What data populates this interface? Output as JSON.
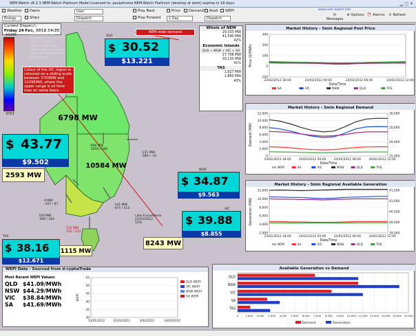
{
  "window": {
    "title": "NEM-Watch v6.2.3 NEM-Watch Platinum Model    Licensed to: paulathome    NEM-Watch Platinum (desktop at work) expires in 18 days.",
    "url": "www.nem-watch.info"
  },
  "toolbar": {
    "checkboxes": [
      {
        "label": "Weather"
      },
      {
        "label": "Dams"
      },
      {
        "label": "Energy"
      },
      {
        "label": "Ships"
      },
      {
        "label": "Play Back"
      },
      {
        "label": "Play Forward"
      },
      {
        "label": "Price"
      },
      {
        "label": "Demand"
      },
      {
        "label": "Avail"
      },
      {
        "label": "WEPI"
      },
      {
        "label": "Dispatch"
      }
    ],
    "user_select": "User",
    "energy_select": "Energy",
    "dispatch_select": "Dispatch",
    "interval_select": "1 Day",
    "dispatch2_select": "Dispatch",
    "buttons": {
      "messages": "Messages",
      "options": "Options",
      "alarms": "Alarms",
      "refresh": "Refresh"
    }
  },
  "current_dispatch": {
    "label": "Current Dispatch:",
    "value": "Friday 24 Feb, 2012 14:25"
  },
  "scale": {
    "max": "10296",
    "min": "3703"
  },
  "info_note": "NEM-Watch only receives data sets when they are released for the first time - in other words, price (or other data) revisions are not received by NEM-Watch.",
  "annotations": {
    "vic_colour": "Colour of the VIC region is coloured on a sliding scale between 3703MW and 10296MW, where the upper range is all-time max on same basis.",
    "nem_demand": "NEM-wide demand"
  },
  "regions": {
    "qld": {
      "code": "QLD",
      "price": "30.52",
      "volume": "$13.221",
      "demand": "6798 MW"
    },
    "sa": {
      "price": "43.77",
      "volume": "$9.502",
      "demand": "2593 MW"
    },
    "nsw": {
      "code": "NSW",
      "price": "34.87",
      "volume": "$9.563",
      "demand": "10584 MW"
    },
    "vic": {
      "code": "VIC",
      "price": "39.88",
      "volume": "$8.855",
      "demand": "8243 MW"
    },
    "tas": {
      "code": "TAS",
      "price": "38.16",
      "volume": "$12.671",
      "demand": "1115 MW"
    }
  },
  "dollar": "$",
  "interconnectors": {
    "qni": "-946 MW",
    "qni_sub": "-1059 / 269",
    "dirlink": "-121 MW",
    "dirlink_sub": "-180 / -33",
    "vic_nsw": "-341 MW",
    "vic_nsw_sub": "-475 / 413",
    "murraylink": "9 MW",
    "murraylink_sub": "-107 / 87",
    "heywood": "330 MW",
    "heywood_sub": "-460 / 362",
    "basslink": "512 MW",
    "basslink_sub": "512 / 512"
  },
  "lake": {
    "label": "Lake Eucumbene",
    "date": "21/02/2012",
    "pct": "53%"
  },
  "whole_nem": {
    "title": "Whole of NEM",
    "rows": [
      {
        "value": "29,333 MW"
      },
      {
        "value": "41,590 MW"
      },
      {
        "value": "42%"
      }
    ],
    "islands_title": "Economic Islands",
    "islands_sub": "QLD + NSW + VIC + SA",
    "island_rows": [
      {
        "value": "27,706 MW"
      },
      {
        "value": "39,130 MW"
      },
      {
        "value": "41%"
      }
    ],
    "tas_title": "TAS",
    "tas_rows": [
      {
        "value": "1,627 MW"
      },
      {
        "value": "2,860 MW"
      },
      {
        "value": "43%"
      }
    ]
  },
  "chart_data": [
    {
      "type": "line",
      "title": "Market History - 5min Regional Pool Price",
      "ylabel": "Price ($/MWh)",
      "xlabel": "Date/Time",
      "x_ticks": [
        "23/02/2012 18:00",
        "24/02/2012 00:00",
        "24/02/2012 06:00",
        "24/02/2012 12:00"
      ],
      "y_ticks": [
        "300",
        "200",
        "100",
        "0",
        "-100"
      ],
      "ylim": [
        -100,
        300
      ],
      "legend": [
        "SA",
        "VIC",
        "NSW",
        "QLD",
        "TAS"
      ],
      "series": [
        {
          "name": "SA",
          "values": [
            45,
            42,
            40,
            38,
            35,
            30,
            28,
            30,
            34,
            38,
            40,
            42,
            44
          ]
        },
        {
          "name": "VIC",
          "values": [
            40,
            38,
            36,
            34,
            30,
            24,
            20,
            22,
            28,
            33,
            36,
            38,
            40
          ]
        },
        {
          "name": "NSW",
          "values": [
            36,
            34,
            33,
            32,
            30,
            26,
            22,
            24,
            28,
            31,
            33,
            34,
            35
          ]
        },
        {
          "name": "QLD",
          "values": [
            32,
            30,
            30,
            29,
            27,
            24,
            20,
            22,
            26,
            28,
            29,
            30,
            30
          ]
        },
        {
          "name": "TAS",
          "values": [
            40,
            39,
            38,
            38,
            36,
            34,
            32,
            33,
            35,
            37,
            38,
            38,
            38
          ]
        }
      ]
    },
    {
      "type": "line",
      "title": "Market History - 5min Regional Demand",
      "ylabel": "Demand (MW)",
      "xlabel": "Date/Time",
      "x_ticks": [
        "23/02/2012 18:00",
        "24/02/2012 00:00",
        "24/02/2012 06:00",
        "24/02/2012 12:00"
      ],
      "y_ticks": [
        "12,000",
        "10,000",
        "8,000",
        "6,000",
        "4,000",
        "2,000",
        "0"
      ],
      "y2_ticks": [
        "30,000",
        "25,000",
        "20,000",
        "15,000"
      ],
      "ylim": [
        0,
        12000
      ],
      "legend": [
        "NEM",
        "SA",
        "VIC",
        "NSW",
        "QLD",
        "TAS"
      ],
      "series": [
        {
          "name": "NSW",
          "values": [
            10200,
            9800,
            9000,
            8000,
            7200,
            6800,
            7000,
            8200,
            9600,
            10400,
            10600,
            10584
          ]
        },
        {
          "name": "VIC",
          "values": [
            8000,
            7600,
            7000,
            6200,
            5600,
            5200,
            5400,
            6400,
            7600,
            8200,
            8300,
            8243
          ]
        },
        {
          "name": "QLD",
          "values": [
            6900,
            6800,
            6600,
            6200,
            5800,
            5600,
            5700,
            6000,
            6500,
            6800,
            6800,
            6798
          ]
        },
        {
          "name": "SA",
          "values": [
            2600,
            2500,
            2300,
            2000,
            1800,
            1700,
            1800,
            2100,
            2400,
            2550,
            2600,
            2593
          ]
        },
        {
          "name": "TAS",
          "values": [
            1200,
            1150,
            1100,
            1000,
            950,
            900,
            950,
            1050,
            1100,
            1120,
            1115,
            1115
          ]
        }
      ]
    },
    {
      "type": "line",
      "title": "Market History - 5min Regional Available Generation",
      "ylabel": "Generation (MW)",
      "xlabel": "Date/Time",
      "x_ticks": [
        "23/02/2012 18:00",
        "24/02/2012 00:00",
        "24/02/2012 06:00",
        "24/02/2012 12:00"
      ],
      "y_ticks": [
        "12,000",
        "10,000",
        "8,000",
        "6,000",
        "4,000",
        "2,000"
      ],
      "y2_ticks": [
        "41,500",
        "41,000",
        "40,500",
        "40,000",
        "39,500"
      ],
      "ylim": [
        0,
        12000
      ],
      "legend": [
        "NEM",
        "SA",
        "VIC",
        "NSW",
        "QLD",
        "TAS"
      ],
      "series": [
        {
          "name": "NSW",
          "values": [
            12000,
            12100,
            12000,
            11900,
            12000,
            12100,
            12200,
            12300,
            12300,
            12300,
            12300,
            12300
          ]
        },
        {
          "name": "VIC",
          "values": [
            10200,
            10100,
            10000,
            10000,
            9800,
            9700,
            9800,
            10000,
            10100,
            10200,
            10300,
            10300
          ]
        },
        {
          "name": "QLD",
          "values": [
            9600,
            9500,
            9500,
            9400,
            9400,
            9300,
            9400,
            9500,
            9600,
            9600,
            9600,
            9600
          ]
        },
        {
          "name": "SA",
          "values": [
            3200,
            3200,
            3100,
            3100,
            3000,
            3000,
            3000,
            3100,
            3200,
            3200,
            3200,
            3200
          ]
        },
        {
          "name": "TAS",
          "values": [
            2800,
            2800,
            2800,
            2800,
            2800,
            2800,
            2800,
            2800,
            2850,
            2860,
            2860,
            2860
          ]
        }
      ]
    },
    {
      "type": "bar",
      "title": "Available Generation vs Demand",
      "categories": [
        "QLD",
        "NSW",
        "VIC",
        "SA",
        "TAS"
      ],
      "series": [
        {
          "name": "Demand",
          "values": [
            6798,
            10584,
            8243,
            2593,
            1115
          ]
        },
        {
          "name": "Generation",
          "values": [
            10600,
            14200,
            11000,
            3700,
            2860
          ]
        }
      ],
      "x_ticks": [
        "0",
        "1,000",
        "2,000",
        "3,000",
        "4,000",
        "5,000",
        "6,000",
        "7,000",
        "8,000",
        "9,000",
        "10,000",
        "11,000",
        "12,000",
        "13,000",
        "14,000",
        "15,000"
      ],
      "xlim": [
        0,
        15000
      ],
      "legend": [
        "Demand",
        "Generation"
      ]
    },
    {
      "type": "scatter",
      "title": "WEPI Data - Sourced from d-cyphaTrade",
      "ylabel": "WEPI",
      "x_ticks": [
        "12/01/2012",
        "21/01/2012",
        "3/02/2012",
        "14/02/2012"
      ],
      "y_ticks": [
        "55",
        "50",
        "45",
        "40",
        "35",
        "30"
      ],
      "ylim": [
        30,
        55
      ],
      "legend": [
        "QLD WEPI",
        "VIC WEPI",
        "NSW WEPI",
        "SA WEPI"
      ]
    }
  ],
  "wepi": {
    "title": "WEPI Data - Sourced from d-cyphaTrade",
    "values_title": "Most Recent WEPI Values:",
    "rows": [
      {
        "region": "QLD",
        "value": "$41.09/MWh"
      },
      {
        "region": "NSW",
        "value": "$44.29/MWh"
      },
      {
        "region": "VIC",
        "value": "$38.84/MWh"
      },
      {
        "region": "SA",
        "value": "$41.69/MWh"
      }
    ]
  },
  "colors": {
    "SA": "#ff3030",
    "VIC": "#2050d0",
    "NSW": "#303030",
    "QLD": "#a03090",
    "TAS": "#40a040",
    "NEM": "#b0b0b0",
    "price_bg": "#00d8d8",
    "volume_bar": "#0a3aa8"
  }
}
